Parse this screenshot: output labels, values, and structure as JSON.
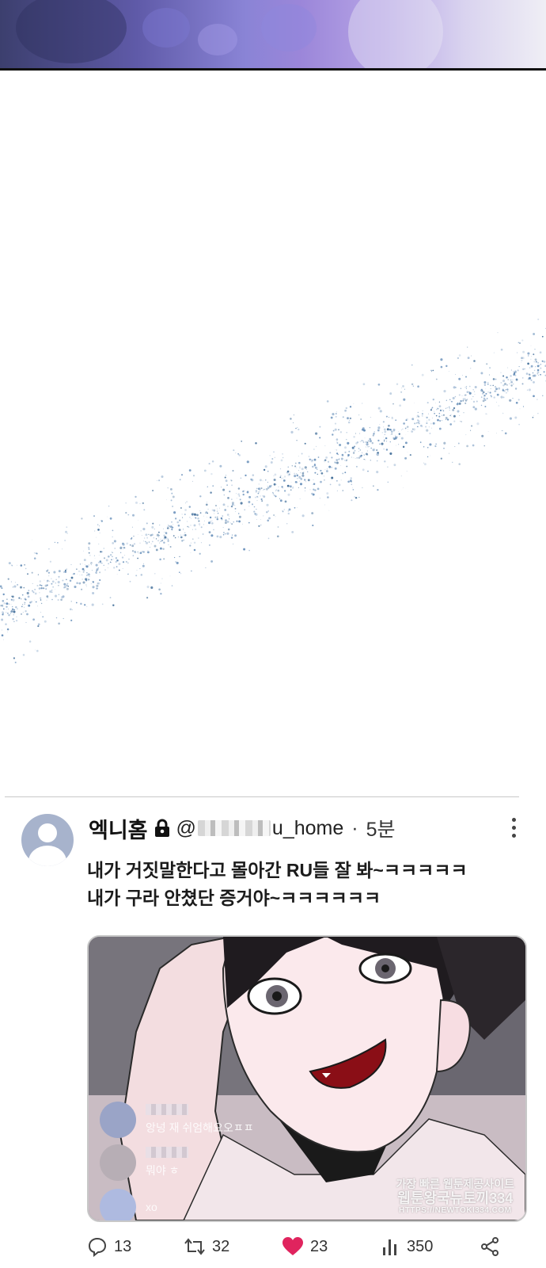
{
  "tweet": {
    "display_name": "엑니홈",
    "handle_prefix": "@",
    "handle_suffix": "u_home",
    "separator": "·",
    "time": "5분",
    "text_lines": [
      "내가 거짓말한다고 몰아간 RU들 잘 봐~ㅋㅋㅋㅋㅋ",
      "내가 구라 안쳤단 증거야~ㅋㅋㅋㅋㅋㅋ"
    ],
    "media": {
      "chat_messages": [
        "앙넝 재 쉬엄해요오ㅍㅍ",
        "뭐야 ㅎ",
        "xo"
      ],
      "watermark_lines": [
        "가장 빠른 웹툰제공사이트",
        "웹툰왕국뉴토끼334",
        "HTTPS://NEWTOKI334.COM"
      ]
    },
    "stats": {
      "replies": "13",
      "retweets": "32",
      "likes": "23",
      "views": "350"
    }
  },
  "colors": {
    "like": "#e0245e",
    "avatar_bg": "#a7b3cc",
    "text": "#1b1b1b"
  }
}
